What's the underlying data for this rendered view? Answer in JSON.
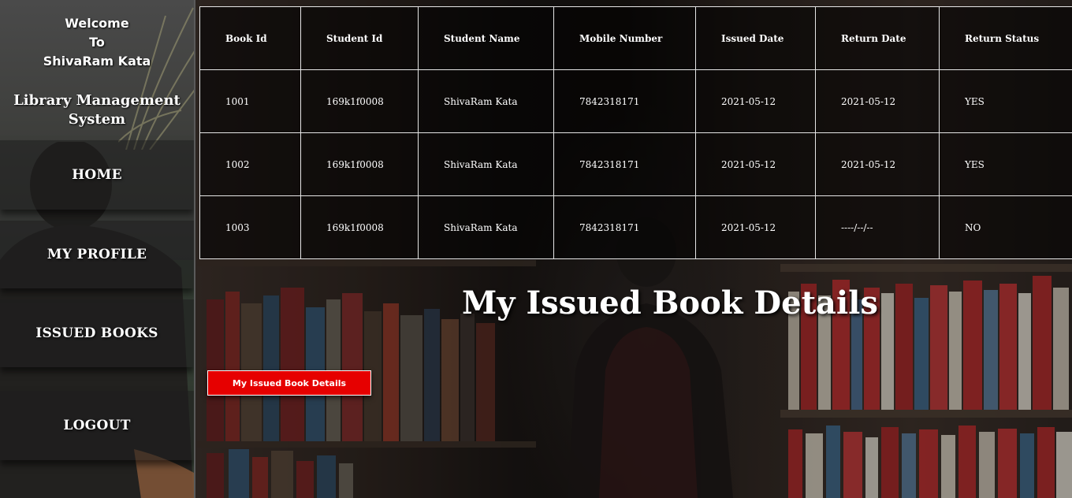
{
  "sidebar": {
    "welcome_line1": "Welcome",
    "welcome_line2": "To",
    "welcome_line3": "ShivaRam Kata",
    "system_title_line1": "Library Management",
    "system_title_line2": "System",
    "nav": {
      "home": "HOME",
      "my_profile": "MY PROFILE",
      "issued_books": "ISSUED BOOKS",
      "logout": "LOGOUT"
    }
  },
  "table": {
    "headers": [
      "Book Id",
      "Student Id",
      "Student Name",
      "Mobile Number",
      "Issued Date",
      "Return Date",
      "Return Status"
    ],
    "rows": [
      [
        "1001",
        "169k1f0008",
        "ShivaRam Kata",
        "7842318171",
        "2021-05-12",
        "2021-05-12",
        "YES"
      ],
      [
        "1002",
        "169k1f0008",
        "ShivaRam Kata",
        "7842318171",
        "2021-05-12",
        "2021-05-12",
        "YES"
      ],
      [
        "1003",
        "169k1f0008",
        "ShivaRam Kata",
        "7842318171",
        "2021-05-12",
        "----/--/--",
        "NO"
      ]
    ]
  },
  "main": {
    "heading": "My Issued Book Details",
    "button_label": "My Issued Book Details"
  },
  "colors": {
    "button_bg": "#e60000",
    "table_border": "#e6e6e6"
  }
}
